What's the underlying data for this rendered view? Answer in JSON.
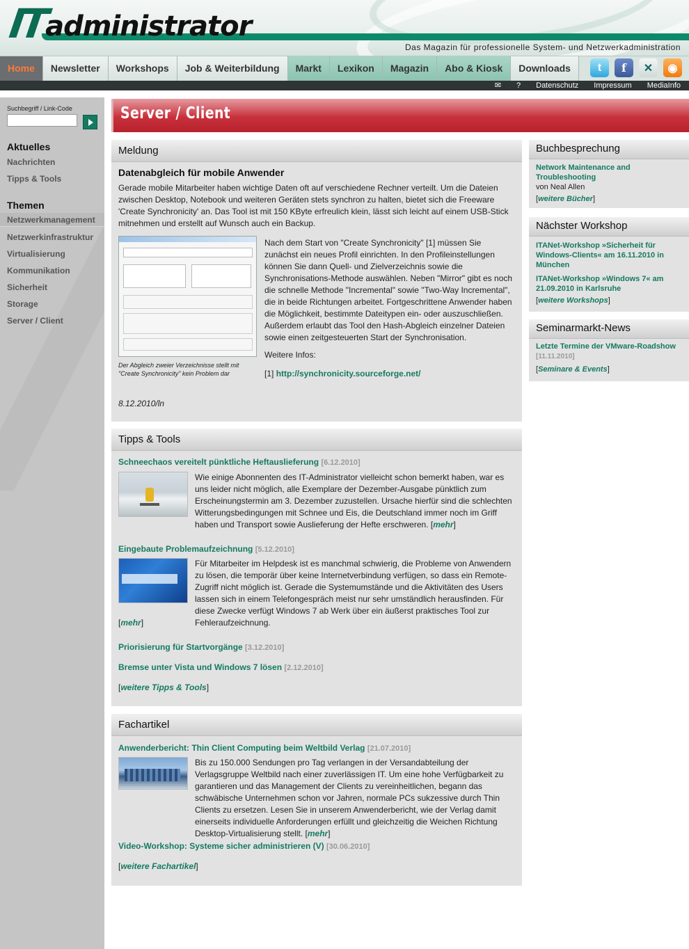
{
  "header": {
    "logo_it": "IT",
    "logo_word": "administrator",
    "tagline": "Das Magazin für professionelle System- und Netzwerkadministration"
  },
  "nav": {
    "items": [
      "Home",
      "Newsletter",
      "Workshops",
      "Job & Weiterbildung",
      "Markt",
      "Lexikon",
      "Magazin",
      "Abo & Kiosk",
      "Downloads"
    ],
    "active": "Home"
  },
  "social": [
    "twitter-icon",
    "facebook-icon",
    "xing-icon",
    "rss-icon"
  ],
  "servicebar": {
    "mail_icon": "envelope-icon",
    "help": "?",
    "links": [
      "Datenschutz",
      "Impressum",
      "MediaInfo"
    ]
  },
  "sidebar": {
    "search_label": "Suchbegriff / Link-Code",
    "search_value": "",
    "aktuelles_heading": "Aktuelles",
    "aktuelles_items": [
      "Nachrichten",
      "Tipps & Tools"
    ],
    "themen_heading": "Themen",
    "themen_items": [
      "Netzwerkmanagement",
      "Netzwerkinfrastruktur",
      "Virtualisierung",
      "Kommunikation",
      "Sicherheit",
      "Storage",
      "Server / Client"
    ]
  },
  "page": {
    "title": "Server / Client"
  },
  "meldung": {
    "heading": "Meldung",
    "title": "Datenabgleich für mobile Anwender",
    "intro": "Gerade mobile Mitarbeiter haben wichtige Daten oft auf verschiedene Rechner verteilt. Um die Dateien zwischen Desktop, Notebook und weiteren Geräten stets synchron zu halten, bietet sich die Freeware 'Create Synchronicity' an. Das Tool ist mit 150 KByte erfreulich klein, lässt sich leicht auf einem USB-Stick mitnehmen und erstellt auf Wunsch auch ein Backup.",
    "body": "Nach dem Start von \"Create Synchronicity\" [1] müssen Sie zunächst ein neues Profil einrichten. In den Profileinstellungen können Sie dann Quell- und Zielverzeichnis sowie die Synchronisations-Methode auswählen. Neben \"Mirror\" gibt es noch die schnelle Methode \"Incremental\" sowie \"Two-Way Incremental\", die in beide Richtungen arbeitet. Fortgeschrittene Anwender haben die Möglichkeit, bestimmte Dateitypen ein- oder auszuschließen. Außerdem erlaubt das Tool den Hash-Abgleich einzelner Dateien sowie einen zeitgesteuerten Start der Synchronisation.",
    "more_info": "Weitere Infos:",
    "ref_label": "[1]",
    "ref_link": "http://synchronicity.sourceforge.net/",
    "caption": "Der Abgleich zweier Verzeichnisse stellt mit \"Create Synchronicity\" kein Problem dar",
    "date": "8.12.2010/ln"
  },
  "tipps": {
    "heading": "Tipps & Tools",
    "items": [
      {
        "title": "Schneechaos vereitelt pünktliche Heftauslieferung",
        "date": "[6.12.2010]",
        "text": "Wie einige Abonnenten des IT-Administrator vielleicht schon bemerkt haben, war es uns leider nicht möglich, alle Exemplare der Dezember-Ausgabe pünktlich zum Erscheinungstermin am 3. Dezember zuzustellen. Ursache hierfür sind die schlechten Witterungsbedingungen mit Schnee und Eis, die Deutschland immer noch im Griff haben und Transport sowie Auslieferung der Hefte erschweren.",
        "more": "mehr"
      },
      {
        "title": "Eingebaute Problemaufzeichnung",
        "date": "[5.12.2010]",
        "text": "Für Mitarbeiter im Helpdesk ist es manchmal schwierig, die Probleme von Anwendern zu lösen, die temporär über keine Internetverbindung verfügen, so dass ein Remote-Zugriff nicht möglich ist. Gerade die Systemumstände und die Aktivitäten des Users lassen sich in einem Telefongespräch meist nur sehr umständlich herausfinden. Für diese Zwecke verfügt Windows 7 ab Werk über ein äußerst praktisches Tool zur Fehleraufzeichnung.",
        "more": "mehr"
      },
      {
        "title": "Priorisierung für Startvorgänge",
        "date": "[3.12.2010]"
      },
      {
        "title": "Bremse unter Vista und Windows 7 lösen",
        "date": "[2.12.2010]"
      }
    ],
    "more": "weitere Tipps & Tools"
  },
  "fachartikel": {
    "heading": "Fachartikel",
    "items": [
      {
        "title": "Anwenderbericht: Thin Client Computing beim Weltbild Verlag",
        "date": "[21.07.2010]",
        "text": "Bis zu 150.000 Sendungen pro Tag verlangen in der Versandabteilung der Verlagsgruppe Weltbild nach einer zuverlässigen IT. Um eine hohe Verfügbarkeit zu garantieren und das Management der Clients zu vereinheitlichen, begann das schwäbische Unternehmen schon vor Jahren, normale PCs sukzessive durch Thin Clients zu ersetzen. Lesen Sie in unserem Anwenderbericht, wie der Verlag damit einerseits individuelle Anforderungen erfüllt und gleichzeitig die Weichen Richtung Desktop-Virtualisierung stellt.",
        "more": "mehr"
      },
      {
        "title": "Video-Workshop: Systeme sicher administrieren (V)",
        "date": "[30.06.2010]"
      }
    ],
    "more": "weitere Fachartikel"
  },
  "buch": {
    "heading": "Buchbesprechung",
    "title": "Network Maintenance and Troubleshooting",
    "author": "von Neal Allen",
    "more": "weitere Bücher"
  },
  "workshop": {
    "heading": "Nächster Workshop",
    "items": [
      "ITANet-Workshop »Sicherheit für Windows-Clients« am 16.11.2010 in München",
      "ITANet-Workshop »Windows 7« am 21.09.2010 in Karlsruhe"
    ],
    "more": "weitere Workshops"
  },
  "seminar": {
    "heading": "Seminarmarkt-News",
    "title": "Letzte Termine der VMware-Roadshow",
    "date": "[11.11.2010]",
    "more": "Seminare & Events"
  }
}
